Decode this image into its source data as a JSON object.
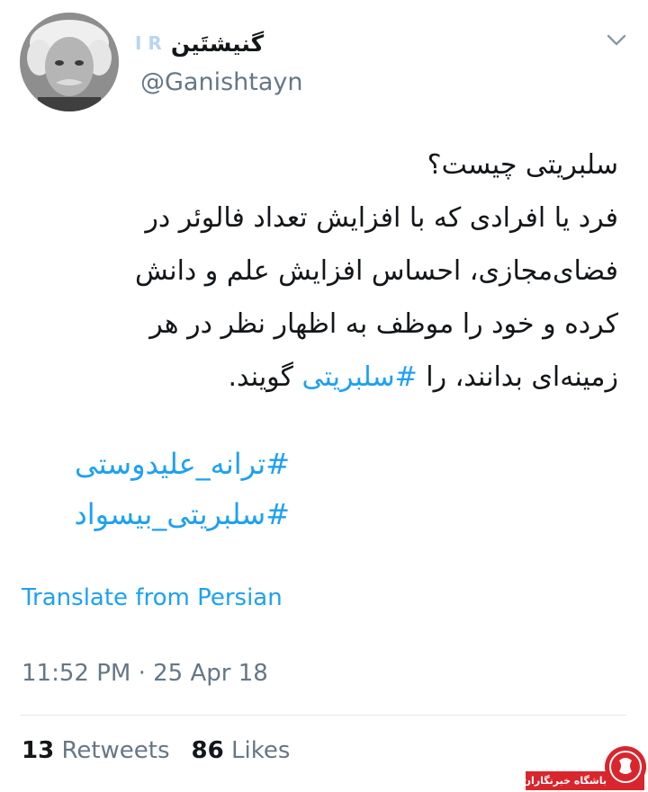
{
  "user": {
    "display_name": "گنیشتَین",
    "flag_letters": "I R",
    "handle": "@Ganishtayn",
    "avatar_icon": "portrait-avatar"
  },
  "tweet": {
    "lines": [
      "سلبریتی چیست؟",
      "فرد یا افرادی که با افزایش تعداد فالوئر در",
      "فضای‌مجازی، احساس افزایش علم و دانش",
      "کرده و خود را موظف به اظهار نظر در هر"
    ],
    "last_line_pre": "زمینه‌ای بدانند، را ",
    "last_line_hashtag": "#سلبریتی",
    "last_line_post": " گویند.",
    "hashtags": [
      "#ترانه_علیدوستی",
      "#سلبریتی_بیسواد"
    ]
  },
  "translate_label": "Translate from Persian",
  "timestamp": "11:52 PM · 25 Apr 18",
  "stats": {
    "retweets_count": "13",
    "retweets_label": "Retweets",
    "likes_count": "86",
    "likes_label": "Likes"
  },
  "watermark": {
    "text": "باشگاه خبرنگاران"
  },
  "colors": {
    "link": "#1da1f2",
    "secondary": "#657786",
    "primary_text": "#14171a",
    "watermark_red": "#d9262d"
  }
}
